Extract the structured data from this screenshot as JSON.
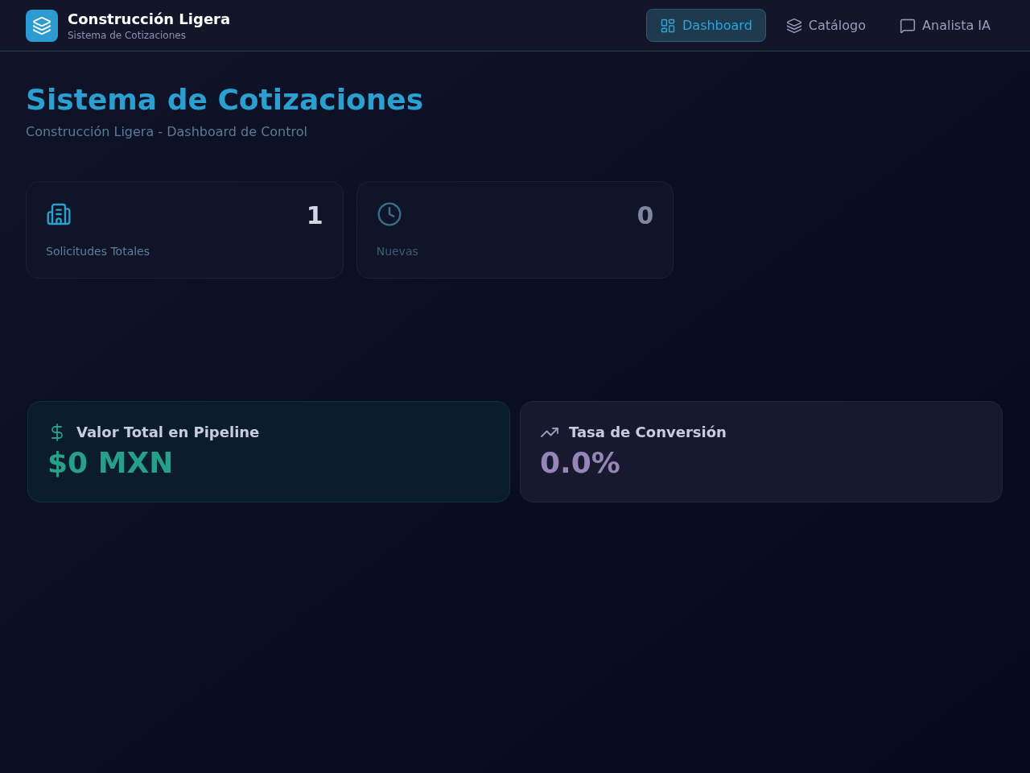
{
  "header": {
    "title": "Construcción Ligera",
    "subtitle": "Sistema de Cotizaciones"
  },
  "nav": [
    {
      "label": "Dashboard",
      "kind": "dashboard",
      "selected": true
    },
    {
      "label": "Catálogo",
      "kind": "catalog",
      "selected": false
    },
    {
      "label": "Analista IA",
      "kind": "chat",
      "selected": false
    }
  ],
  "page": {
    "title": "Sistema de Cotizaciones",
    "subtitle": "Construcción Ligera - Dashboard de Control"
  },
  "stats": [
    {
      "kind": "requests",
      "value": "1",
      "label": "Solicitudes Totales"
    },
    {
      "kind": "new",
      "value": "0",
      "label": "Nuevas"
    }
  ],
  "metrics": [
    {
      "kind": "pipeline",
      "title": "Valor Total en Pipeline",
      "value": "$0 MXN"
    },
    {
      "kind": "conversion",
      "title": "Tasa de Conversión",
      "value": "0.0%"
    }
  ]
}
